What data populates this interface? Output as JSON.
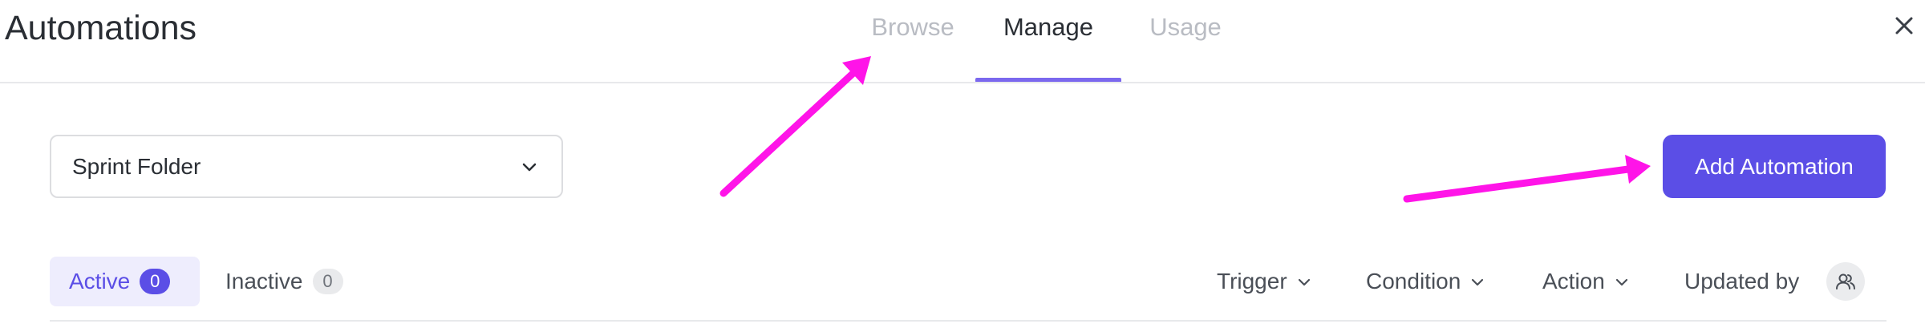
{
  "header": {
    "title": "Automations",
    "tabs": [
      {
        "label": "Browse",
        "active": false
      },
      {
        "label": "Manage",
        "active": true
      },
      {
        "label": "Usage",
        "active": false
      }
    ],
    "close_icon": "close-icon"
  },
  "toolbar": {
    "folder_select_value": "Sprint Folder",
    "add_button_label": "Add Automation"
  },
  "status_tabs": {
    "active": {
      "label": "Active",
      "count": "0"
    },
    "inactive": {
      "label": "Inactive",
      "count": "0"
    }
  },
  "filters": {
    "trigger": "Trigger",
    "condition": "Condition",
    "action": "Action",
    "updated_by": "Updated by",
    "updated_by_icon": "people-icon"
  },
  "colors": {
    "accent": "#5b4ee6",
    "tab_underline": "#7b68ee",
    "annotation_arrow": "#ff14e8"
  }
}
